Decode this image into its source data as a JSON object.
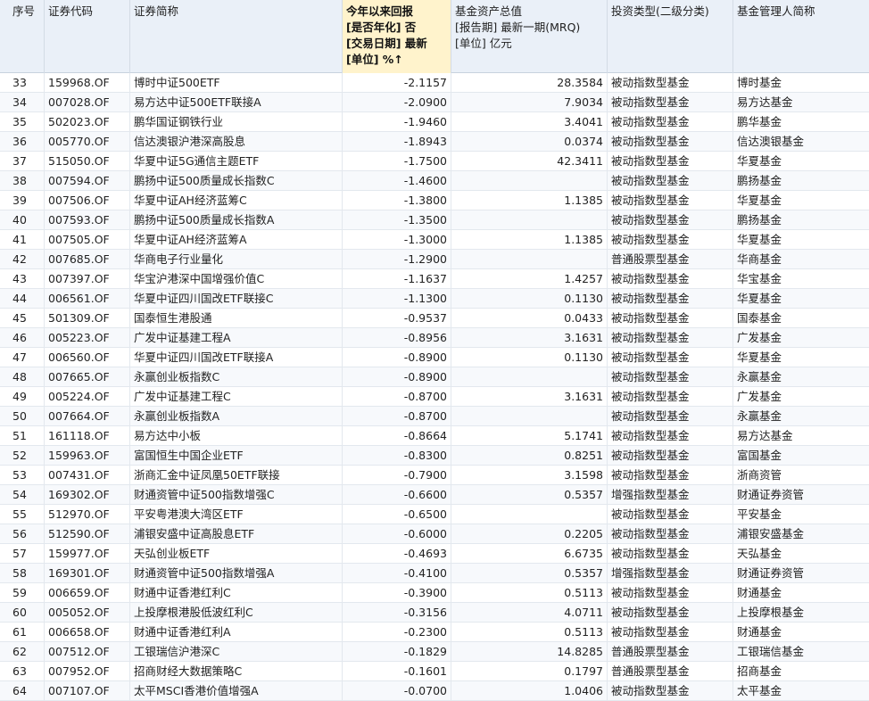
{
  "headers": {
    "seq": "序号",
    "code": "证券代码",
    "name": "证券简称",
    "ytd": [
      "今年以来回报",
      "[是否年化] 否",
      "[交易日期] 最新",
      "[单位] %↑"
    ],
    "aum": [
      "基金资产总值",
      "[报告期] 最新一期(MRQ)",
      "[单位] 亿元"
    ],
    "type": "投资类型(二级分类)",
    "manager": "基金管理人简称"
  },
  "rows": [
    {
      "seq": "33",
      "code": "159968.OF",
      "name": "博时中证500ETF",
      "ytd": "-2.1157",
      "aum": "28.3584",
      "type": "被动指数型基金",
      "manager": "博时基金"
    },
    {
      "seq": "34",
      "code": "007028.OF",
      "name": "易方达中证500ETF联接A",
      "ytd": "-2.0900",
      "aum": "7.9034",
      "type": "被动指数型基金",
      "manager": "易方达基金"
    },
    {
      "seq": "35",
      "code": "502023.OF",
      "name": "鹏华国证钢铁行业",
      "ytd": "-1.9460",
      "aum": "3.4041",
      "type": "被动指数型基金",
      "manager": "鹏华基金"
    },
    {
      "seq": "36",
      "code": "005770.OF",
      "name": "信达澳银沪港深高股息",
      "ytd": "-1.8943",
      "aum": "0.0374",
      "type": "被动指数型基金",
      "manager": "信达澳银基金"
    },
    {
      "seq": "37",
      "code": "515050.OF",
      "name": "华夏中证5G通信主题ETF",
      "ytd": "-1.7500",
      "aum": "42.3411",
      "type": "被动指数型基金",
      "manager": "华夏基金"
    },
    {
      "seq": "38",
      "code": "007594.OF",
      "name": "鹏扬中证500质量成长指数C",
      "ytd": "-1.4600",
      "aum": "",
      "type": "被动指数型基金",
      "manager": "鹏扬基金"
    },
    {
      "seq": "39",
      "code": "007506.OF",
      "name": "华夏中证AH经济蓝筹C",
      "ytd": "-1.3800",
      "aum": "1.1385",
      "type": "被动指数型基金",
      "manager": "华夏基金"
    },
    {
      "seq": "40",
      "code": "007593.OF",
      "name": "鹏扬中证500质量成长指数A",
      "ytd": "-1.3500",
      "aum": "",
      "type": "被动指数型基金",
      "manager": "鹏扬基金"
    },
    {
      "seq": "41",
      "code": "007505.OF",
      "name": "华夏中证AH经济蓝筹A",
      "ytd": "-1.3000",
      "aum": "1.1385",
      "type": "被动指数型基金",
      "manager": "华夏基金"
    },
    {
      "seq": "42",
      "code": "007685.OF",
      "name": "华商电子行业量化",
      "ytd": "-1.2900",
      "aum": "",
      "type": "普通股票型基金",
      "manager": "华商基金"
    },
    {
      "seq": "43",
      "code": "007397.OF",
      "name": "华宝沪港深中国增强价值C",
      "ytd": "-1.1637",
      "aum": "1.4257",
      "type": "被动指数型基金",
      "manager": "华宝基金"
    },
    {
      "seq": "44",
      "code": "006561.OF",
      "name": "华夏中证四川国改ETF联接C",
      "ytd": "-1.1300",
      "aum": "0.1130",
      "type": "被动指数型基金",
      "manager": "华夏基金"
    },
    {
      "seq": "45",
      "code": "501309.OF",
      "name": "国泰恒生港股通",
      "ytd": "-0.9537",
      "aum": "0.0433",
      "type": "被动指数型基金",
      "manager": "国泰基金"
    },
    {
      "seq": "46",
      "code": "005223.OF",
      "name": "广发中证基建工程A",
      "ytd": "-0.8956",
      "aum": "3.1631",
      "type": "被动指数型基金",
      "manager": "广发基金"
    },
    {
      "seq": "47",
      "code": "006560.OF",
      "name": "华夏中证四川国改ETF联接A",
      "ytd": "-0.8900",
      "aum": "0.1130",
      "type": "被动指数型基金",
      "manager": "华夏基金"
    },
    {
      "seq": "48",
      "code": "007665.OF",
      "name": "永赢创业板指数C",
      "ytd": "-0.8900",
      "aum": "",
      "type": "被动指数型基金",
      "manager": "永赢基金"
    },
    {
      "seq": "49",
      "code": "005224.OF",
      "name": "广发中证基建工程C",
      "ytd": "-0.8700",
      "aum": "3.1631",
      "type": "被动指数型基金",
      "manager": "广发基金"
    },
    {
      "seq": "50",
      "code": "007664.OF",
      "name": "永赢创业板指数A",
      "ytd": "-0.8700",
      "aum": "",
      "type": "被动指数型基金",
      "manager": "永赢基金"
    },
    {
      "seq": "51",
      "code": "161118.OF",
      "name": "易方达中小板",
      "ytd": "-0.8664",
      "aum": "5.1741",
      "type": "被动指数型基金",
      "manager": "易方达基金"
    },
    {
      "seq": "52",
      "code": "159963.OF",
      "name": "富国恒生中国企业ETF",
      "ytd": "-0.8300",
      "aum": "0.8251",
      "type": "被动指数型基金",
      "manager": "富国基金"
    },
    {
      "seq": "53",
      "code": "007431.OF",
      "name": "浙商汇金中证凤凰50ETF联接",
      "ytd": "-0.7900",
      "aum": "3.1598",
      "type": "被动指数型基金",
      "manager": "浙商资管"
    },
    {
      "seq": "54",
      "code": "169302.OF",
      "name": "财通资管中证500指数增强C",
      "ytd": "-0.6600",
      "aum": "0.5357",
      "type": "增强指数型基金",
      "manager": "财通证券资管"
    },
    {
      "seq": "55",
      "code": "512970.OF",
      "name": "平安粤港澳大湾区ETF",
      "ytd": "-0.6500",
      "aum": "",
      "type": "被动指数型基金",
      "manager": "平安基金"
    },
    {
      "seq": "56",
      "code": "512590.OF",
      "name": "浦银安盛中证高股息ETF",
      "ytd": "-0.6000",
      "aum": "0.2205",
      "type": "被动指数型基金",
      "manager": "浦银安盛基金"
    },
    {
      "seq": "57",
      "code": "159977.OF",
      "name": "天弘创业板ETF",
      "ytd": "-0.4693",
      "aum": "6.6735",
      "type": "被动指数型基金",
      "manager": "天弘基金"
    },
    {
      "seq": "58",
      "code": "169301.OF",
      "name": "财通资管中证500指数增强A",
      "ytd": "-0.4100",
      "aum": "0.5357",
      "type": "增强指数型基金",
      "manager": "财通证券资管"
    },
    {
      "seq": "59",
      "code": "006659.OF",
      "name": "财通中证香港红利C",
      "ytd": "-0.3900",
      "aum": "0.5113",
      "type": "被动指数型基金",
      "manager": "财通基金"
    },
    {
      "seq": "60",
      "code": "005052.OF",
      "name": "上投摩根港股低波红利C",
      "ytd": "-0.3156",
      "aum": "4.0711",
      "type": "被动指数型基金",
      "manager": "上投摩根基金"
    },
    {
      "seq": "61",
      "code": "006658.OF",
      "name": "财通中证香港红利A",
      "ytd": "-0.2300",
      "aum": "0.5113",
      "type": "被动指数型基金",
      "manager": "财通基金"
    },
    {
      "seq": "62",
      "code": "007512.OF",
      "name": "工银瑞信沪港深C",
      "ytd": "-0.1829",
      "aum": "14.8285",
      "type": "普通股票型基金",
      "manager": "工银瑞信基金"
    },
    {
      "seq": "63",
      "code": "007952.OF",
      "name": "招商财经大数据策略C",
      "ytd": "-0.1601",
      "aum": "0.1797",
      "type": "普通股票型基金",
      "manager": "招商基金"
    },
    {
      "seq": "64",
      "code": "007107.OF",
      "name": "太平MSCI香港价值增强A",
      "ytd": "-0.0700",
      "aum": "1.0406",
      "type": "被动指数型基金",
      "manager": "太平基金"
    }
  ]
}
